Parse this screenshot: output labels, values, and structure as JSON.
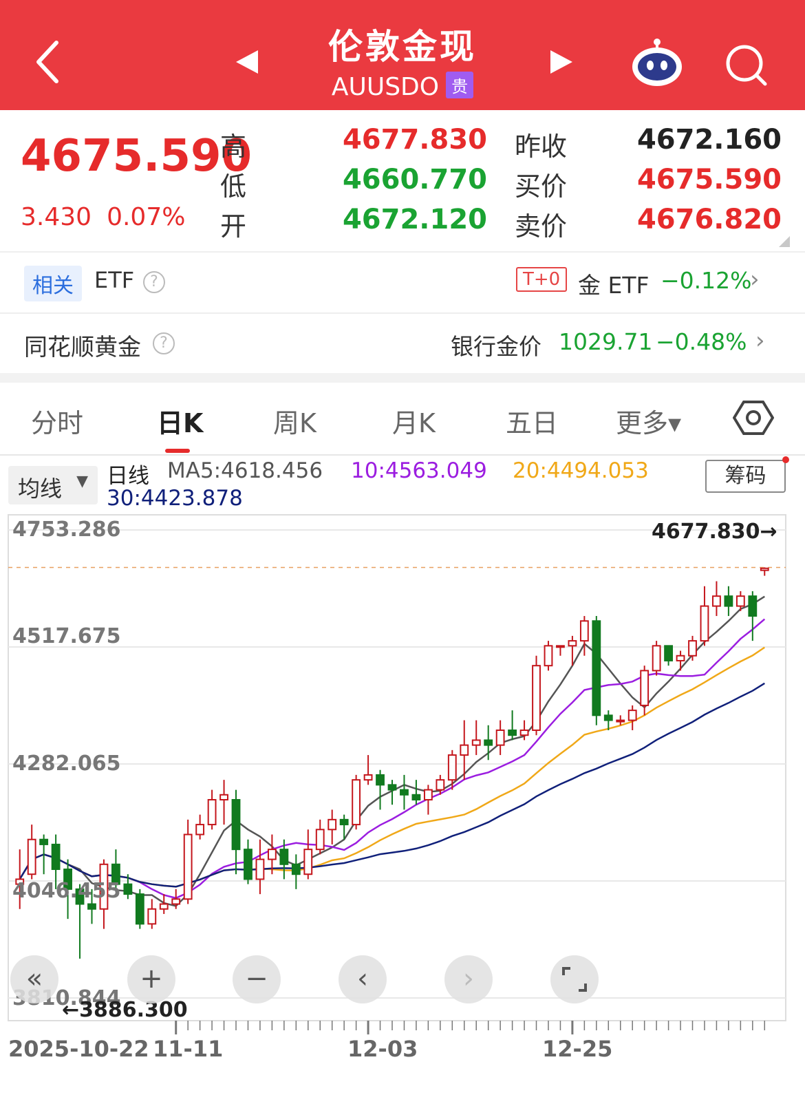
{
  "header": {
    "title": "伦敦金现",
    "code": "AUUSDO",
    "badge": "贵"
  },
  "quote": {
    "price": "4675.590",
    "change": "3.430",
    "change_pct": "0.07%",
    "high_label": "高",
    "high": "4677.830",
    "low_label": "低",
    "low": "4660.770",
    "open_label": "开",
    "open": "4672.120",
    "prev_close_label": "昨收",
    "prev_close": "4672.160",
    "bid_label": "买价",
    "bid": "4675.590",
    "ask_label": "卖价",
    "ask": "4676.820"
  },
  "etf_row": {
    "related_tag": "相关",
    "etf_label": "ETF",
    "t0_tag": "T+0",
    "gold_etf_label": "金 ETF",
    "gold_etf_change": "−0.12%"
  },
  "gold_row": {
    "label": "同花顺黄金",
    "bank_label": "银行金价",
    "bank_price": "1029.71",
    "bank_change": "−0.48%"
  },
  "tabs": [
    "分时",
    "日K",
    "周K",
    "月K",
    "五日",
    "更多▾"
  ],
  "active_tab": 1,
  "ma_legend": {
    "select_label": "均线",
    "period": "日线",
    "ma5": "MA5:4618.456",
    "ma10": "10:4563.049",
    "ma20": "20:4494.053",
    "ma30": "30:4423.878",
    "chips_label": "筹码"
  },
  "colors": {
    "header_bg": "#ea3a40",
    "up": "#e62b2b",
    "down": "#1aa332",
    "candle_up": "#c4161c",
    "candle_down": "#117a1f",
    "ma5": "#555555",
    "ma10": "#9b1de0",
    "ma20": "#f0a818",
    "ma30": "#10207a"
  },
  "icons": [
    "back-chevron-icon",
    "prev-triangle-icon",
    "next-triangle-icon",
    "robot-icon",
    "search-icon",
    "question-icon",
    "chevron-right-icon",
    "settings-hexagon-icon",
    "double-left-icon",
    "plus-icon",
    "minus-icon",
    "left-icon",
    "right-icon",
    "expand-icon"
  ],
  "chart_data": {
    "type": "candlestick",
    "y_ticks": [
      "4753.286",
      "4517.675",
      "4282.065",
      "4046.455",
      "3810.844"
    ],
    "ylim": [
      3810.844,
      4753.286
    ],
    "high_marker": "4677.830→",
    "low_marker": "←3886.300",
    "x_labels": [
      "2025-10-22",
      "11-11",
      "12-03",
      "12-25"
    ],
    "candles": [
      [
        4040,
        4050,
        3990,
        4110
      ],
      [
        4060,
        4130,
        4050,
        4160
      ],
      [
        4130,
        4120,
        4060,
        4140
      ],
      [
        4120,
        4070,
        4030,
        4140
      ],
      [
        4070,
        4030,
        3970,
        4090
      ],
      [
        4030,
        4000,
        3890,
        4040
      ],
      [
        4000,
        3990,
        3960,
        4030
      ],
      [
        3990,
        4080,
        3950,
        4090
      ],
      [
        4080,
        4040,
        4030,
        4110
      ],
      [
        4040,
        4020,
        4010,
        4060
      ],
      [
        4020,
        3960,
        3950,
        4030
      ],
      [
        3960,
        3990,
        3950,
        4010
      ],
      [
        3990,
        4000,
        3980,
        4020
      ],
      [
        4000,
        4010,
        3990,
        4030
      ],
      [
        4010,
        4140,
        4000,
        4170
      ],
      [
        4140,
        4160,
        4130,
        4180
      ],
      [
        4160,
        4210,
        4150,
        4230
      ],
      [
        4210,
        4220,
        4160,
        4250
      ],
      [
        4210,
        4110,
        4060,
        4230
      ],
      [
        4110,
        4050,
        4040,
        4130
      ],
      [
        4050,
        4090,
        4020,
        4130
      ],
      [
        4090,
        4110,
        4060,
        4140
      ],
      [
        4110,
        4080,
        4050,
        4130
      ],
      [
        4080,
        4060,
        4030,
        4100
      ],
      [
        4060,
        4110,
        4050,
        4150
      ],
      [
        4110,
        4150,
        4100,
        4170
      ],
      [
        4150,
        4170,
        4120,
        4190
      ],
      [
        4170,
        4160,
        4130,
        4180
      ],
      [
        4160,
        4250,
        4150,
        4260
      ],
      [
        4250,
        4260,
        4240,
        4300
      ],
      [
        4260,
        4240,
        4190,
        4270
      ],
      [
        4240,
        4230,
        4200,
        4250
      ],
      [
        4230,
        4220,
        4190,
        4260
      ],
      [
        4220,
        4210,
        4200,
        4250
      ],
      [
        4210,
        4230,
        4180,
        4240
      ],
      [
        4230,
        4250,
        4220,
        4260
      ],
      [
        4250,
        4300,
        4230,
        4310
      ],
      [
        4300,
        4320,
        4250,
        4370
      ],
      [
        4320,
        4330,
        4300,
        4370
      ],
      [
        4330,
        4320,
        4290,
        4360
      ],
      [
        4320,
        4350,
        4300,
        4370
      ],
      [
        4350,
        4340,
        4330,
        4390
      ],
      [
        4340,
        4350,
        4330,
        4370
      ],
      [
        4350,
        4480,
        4340,
        4500
      ],
      [
        4480,
        4520,
        4470,
        4530
      ],
      [
        4520,
        4520,
        4500,
        4520
      ],
      [
        4520,
        4530,
        4480,
        4540
      ],
      [
        4530,
        4570,
        4500,
        4580
      ],
      [
        4570,
        4380,
        4360,
        4580
      ],
      [
        4380,
        4370,
        4350,
        4390
      ],
      [
        4370,
        4370,
        4360,
        4380
      ],
      [
        4370,
        4390,
        4350,
        4400
      ],
      [
        4400,
        4470,
        4380,
        4480
      ],
      [
        4470,
        4520,
        4460,
        4530
      ],
      [
        4520,
        4490,
        4480,
        4520
      ],
      [
        4490,
        4500,
        4470,
        4510
      ],
      [
        4500,
        4530,
        4490,
        4540
      ],
      [
        4530,
        4600,
        4520,
        4640
      ],
      [
        4600,
        4620,
        4580,
        4650
      ],
      [
        4620,
        4600,
        4580,
        4640
      ],
      [
        4600,
        4620,
        4590,
        4630
      ],
      [
        4620,
        4580,
        4530,
        4630
      ],
      [
        4672,
        4676,
        4661,
        4678
      ]
    ]
  }
}
